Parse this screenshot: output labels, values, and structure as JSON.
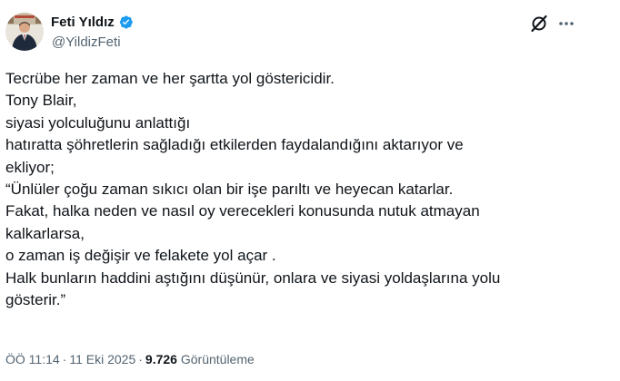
{
  "author": {
    "display_name": "Feti Yıldız",
    "handle": "@YildizFeti"
  },
  "icons": {
    "avatar": "avatar-photo",
    "verified": "verified-badge-icon",
    "grok": "grok-icon",
    "more": "more-options-icon",
    "verified_color": "#1d9bf0"
  },
  "tweet": {
    "lines": [
      "Tecrübe her zaman ve her şartta yol göstericidir.",
      "Tony Blair,",
      "siyasi yolculuğunu anlattığı",
      "hatıratta şöhretlerin sağladığı etkilerden faydalandığını aktarıyor ve",
      "ekliyor;",
      "“Ünlüler çoğu zaman sıkıcı olan bir işe parıltı ve heyecan katarlar.",
      "Fakat, halka neden ve nasıl oy verecekleri konusunda nutuk atmayan",
      "kalkarlarsa,",
      "o zaman iş değişir ve felakete yol açar .",
      "Halk bunların haddini aştığını düşünür, onlara ve siyasi yoldaşlarına yolu",
      "gösterir.”"
    ]
  },
  "meta": {
    "time": "ÖÖ 11:14",
    "separator": "·",
    "date": "11 Eki 2025",
    "views_count": "9.726",
    "views_label": "Görüntüleme"
  }
}
